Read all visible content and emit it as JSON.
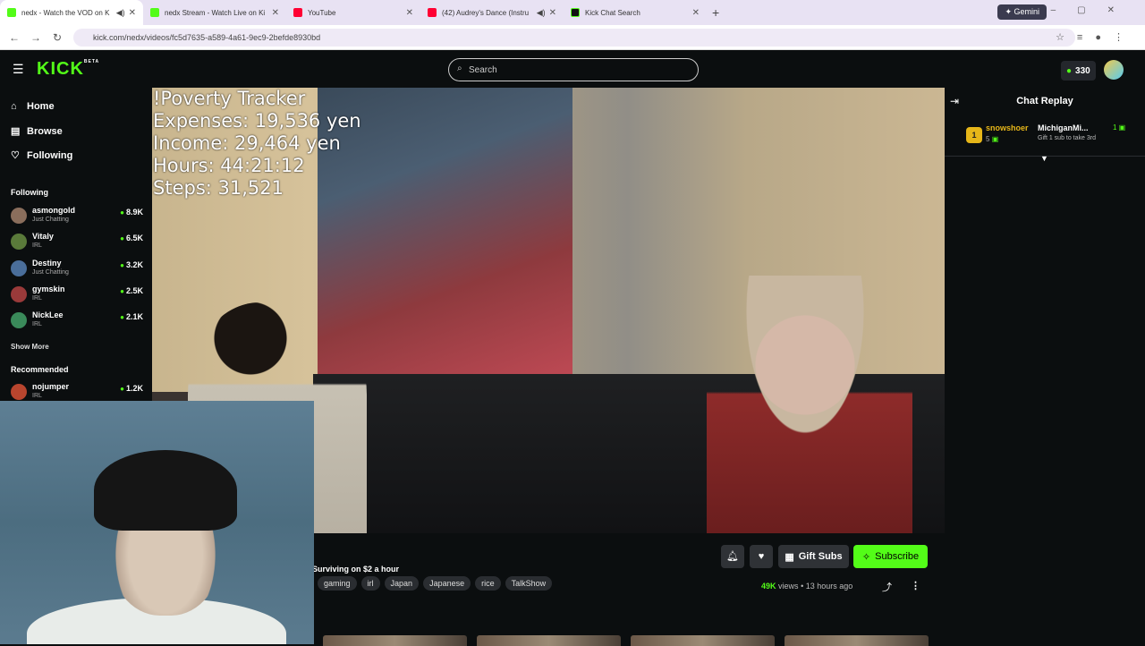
{
  "browser": {
    "tabs": [
      {
        "title": "nedx - Watch the VOD on K",
        "favicon_color": "#53fc18",
        "active": true
      },
      {
        "title": "nedx Stream - Watch Live on Ki",
        "favicon_color": "#53fc18",
        "active": false
      },
      {
        "title": "YouTube",
        "favicon_color": "#ff0033",
        "active": false
      },
      {
        "title": "(42) Audrey's Dance (Instru",
        "favicon_color": "#ff0033",
        "active": false
      },
      {
        "title": "Kick Chat Search",
        "favicon_color": "#111111",
        "active": false
      }
    ],
    "gemini_label": "Gemini",
    "url": "kick.com/nedx/videos/fc5d7635-a589-4a61-9ec9-2befde8930bd"
  },
  "header": {
    "logo": "KICK",
    "logo_badge": "BETA",
    "search_placeholder": "Search",
    "coins": "330"
  },
  "sidebar": {
    "nav": [
      {
        "label": "Home",
        "icon": "home-icon"
      },
      {
        "label": "Browse",
        "icon": "browse-icon"
      },
      {
        "label": "Following",
        "icon": "heart-icon"
      }
    ],
    "following_heading": "Following",
    "following": [
      {
        "name": "asmongold",
        "category": "Just Chatting",
        "viewers": "8.9K",
        "avatar_color": "#8a6e5c"
      },
      {
        "name": "Vitaly",
        "category": "IRL",
        "viewers": "6.5K",
        "avatar_color": "#5a7a3a"
      },
      {
        "name": "Destiny",
        "category": "Just Chatting",
        "viewers": "3.2K",
        "avatar_color": "#4a6e9a"
      },
      {
        "name": "gymskin",
        "category": "IRL",
        "viewers": "2.5K",
        "avatar_color": "#9a3a3a"
      },
      {
        "name": "NickLee",
        "category": "IRL",
        "viewers": "2.1K",
        "avatar_color": "#3a8a5a"
      }
    ],
    "show_more": "Show More",
    "recommended_heading": "Recommended",
    "recommended": [
      {
        "name": "nojumper",
        "category": "IRL",
        "viewers": "1.2K",
        "avatar_color": "#b8452e"
      }
    ]
  },
  "video": {
    "overlay_lines": [
      "!Poverty Tracker",
      "Expenses: 19,536 yen",
      "Income: 29,464 yen",
      "Hours: 44:21:12",
      "Steps: 31,521"
    ]
  },
  "video_info": {
    "title": "Surviving on $2 a hour",
    "tags": [
      "gaming",
      "irl",
      "Japan",
      "Japanese",
      "rice",
      "TalkShow"
    ],
    "gift_label": "Gift Subs",
    "subscribe_label": "Subscribe",
    "views_count": "49K",
    "views_word": "views",
    "separator": "•",
    "time_ago": "13 hours ago"
  },
  "chat": {
    "title": "Chat Replay",
    "leader": {
      "rank": "1",
      "user1": "snowshoer",
      "user1_count": "5",
      "user2": "MichiganMi...",
      "user2_count": "1",
      "user2_sub": "Gift 1 sub to take 3rd"
    }
  }
}
